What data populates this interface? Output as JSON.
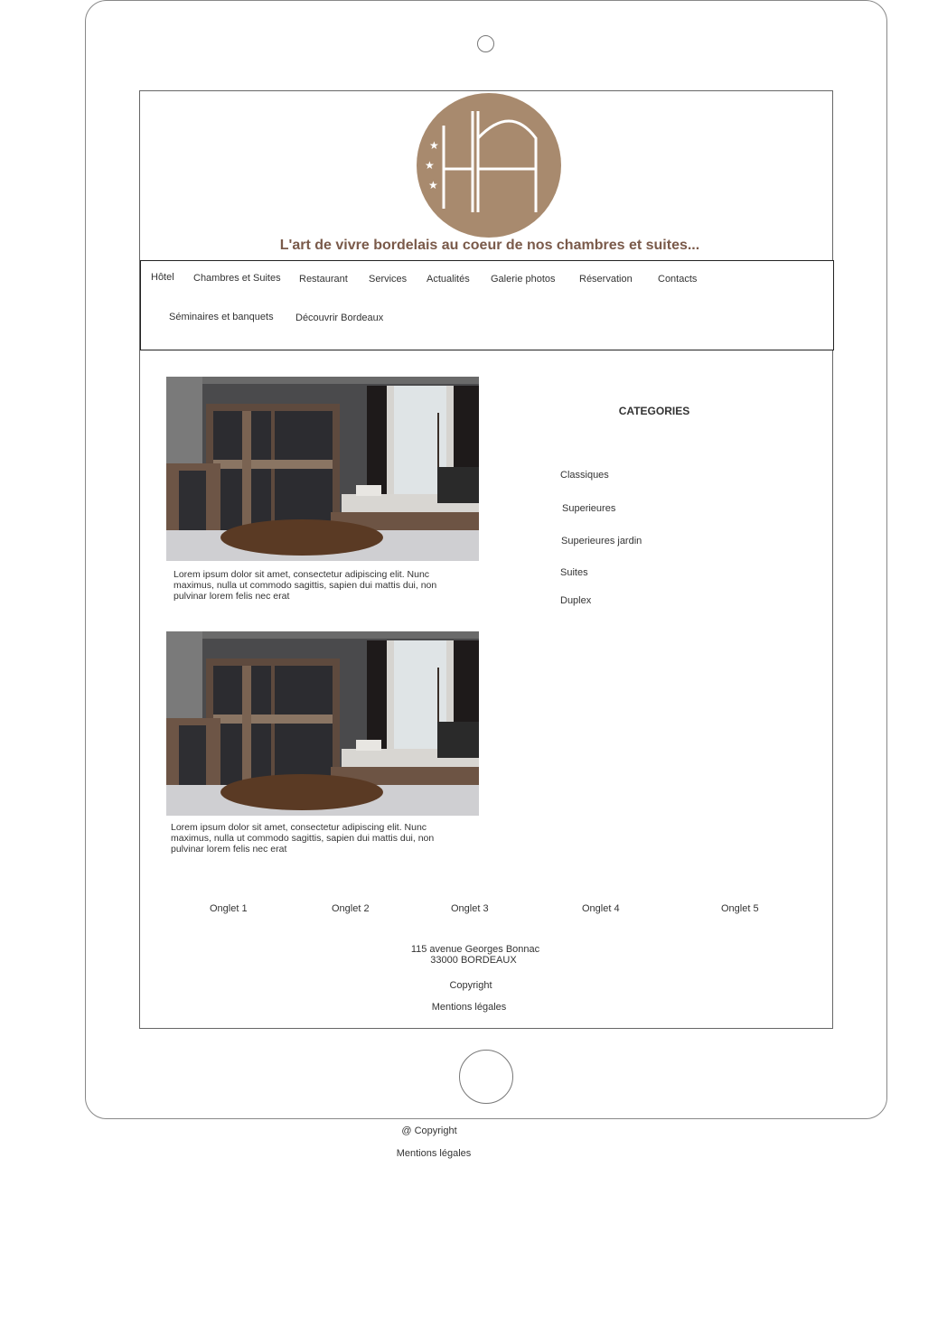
{
  "header": {
    "logo_letters": "HA",
    "tagline": "L'art de vivre bordelais au coeur de nos chambres et suites..."
  },
  "nav": {
    "items": [
      {
        "label": "Hôtel"
      },
      {
        "label": "Chambres et Suites"
      },
      {
        "label": "Restaurant"
      },
      {
        "label": "Services"
      },
      {
        "label": "Actualités"
      },
      {
        "label": "Galerie photos"
      },
      {
        "label": "Réservation"
      },
      {
        "label": "Contacts"
      },
      {
        "label": "Séminaires et banquets"
      },
      {
        "label": "Découvrir Bordeaux"
      }
    ]
  },
  "rooms": [
    {
      "description": "Lorem ipsum dolor sit amet, consectetur adipiscing elit. Nunc maximus, nulla ut commodo sagittis, sapien dui mattis dui, non pulvinar lorem felis nec erat"
    },
    {
      "description": "Lorem ipsum dolor sit amet, consectetur adipiscing elit. Nunc maximus, nulla ut commodo sagittis, sapien dui mattis dui, non pulvinar lorem felis nec erat"
    }
  ],
  "categories": {
    "title": "CATEGORIES",
    "items": [
      "Classiques",
      "Superieures",
      "Superieures jardin",
      "Suites",
      "Duplex"
    ]
  },
  "tabs": [
    "Onglet 1",
    "Onglet 2",
    "Onglet 3",
    "Onglet 4",
    "Onglet 5"
  ],
  "footer": {
    "address_line1": "115 avenue Georges Bonnac",
    "address_line2": "33000 BORDEAUX",
    "copyright": "Copyright",
    "legal": "Mentions légales"
  },
  "outside_footer": {
    "copyright": "@ Copyright",
    "legal": "Mentions légales"
  },
  "colors": {
    "brand": "#a88a6e",
    "tagline": "#7a5a4a"
  }
}
